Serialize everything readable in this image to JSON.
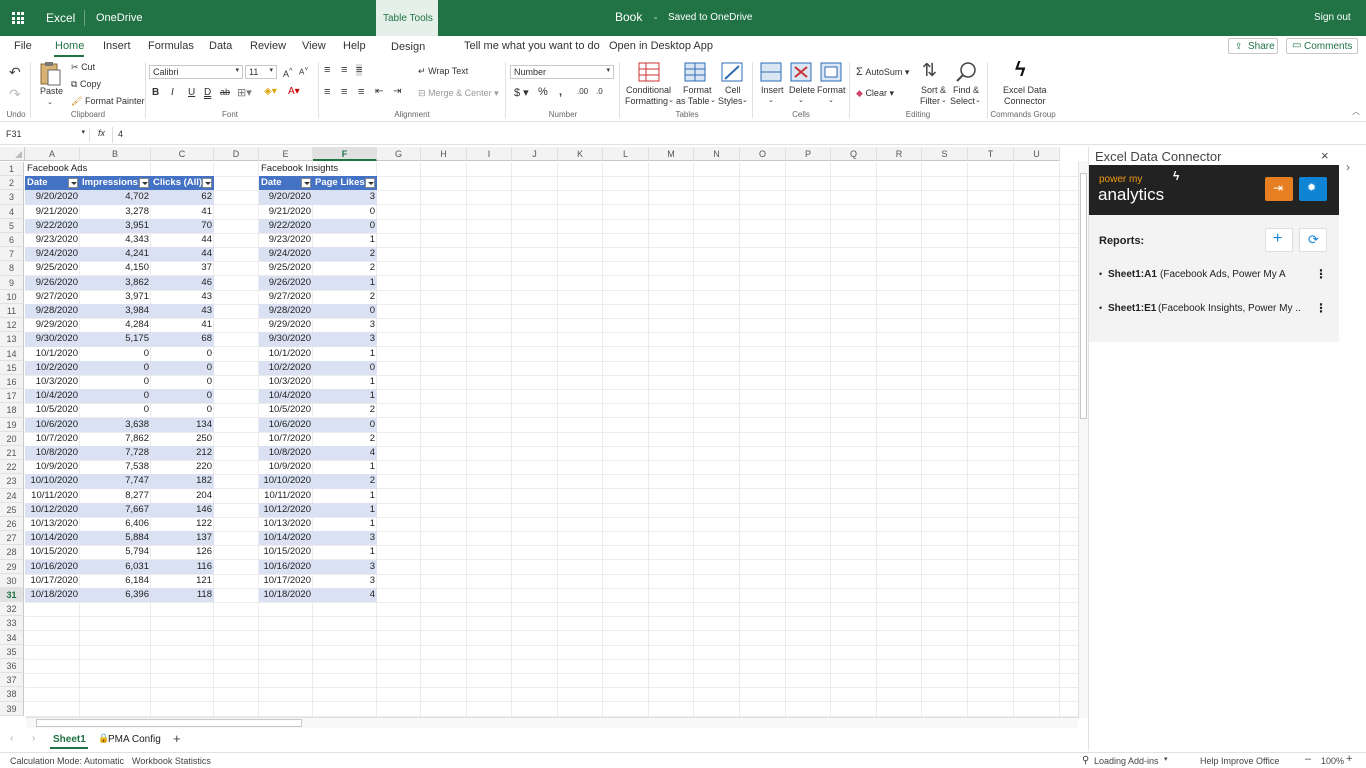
{
  "titlebar": {
    "app": "Excel",
    "location": "OneDrive",
    "context_tab": "Table Tools",
    "book": "Book",
    "save_status": "Saved to OneDrive",
    "signout": "Sign out"
  },
  "tabs": {
    "file": "File",
    "home": "Home",
    "insert": "Insert",
    "formulas": "Formulas",
    "data": "Data",
    "review": "Review",
    "view": "View",
    "help": "Help",
    "design": "Design",
    "tell_me": "Tell me what you want to do",
    "open_desktop": "Open in Desktop App",
    "share": "Share",
    "comments": "Comments"
  },
  "ribbon": {
    "undo_group": "Undo",
    "paste": "Paste",
    "cut": "Cut",
    "copy": "Copy",
    "format_painter": "Format Painter",
    "clipboard": "Clipboard",
    "font_name": "Calibri",
    "font_size": "11",
    "font": "Font",
    "wrap_text": "Wrap Text",
    "merge_center": "Merge & Center",
    "alignment": "Alignment",
    "number_format": "Number",
    "number": "Number",
    "conditional_1": "Conditional",
    "conditional_2": "Formatting",
    "format_table_1": "Format",
    "format_table_2": "as Table",
    "cell_styles_1": "Cell",
    "cell_styles_2": "Styles",
    "tables": "Tables",
    "insert": "Insert",
    "delete": "Delete",
    "format": "Format",
    "cells": "Cells",
    "autosum": "AutoSum",
    "clear": "Clear",
    "sort_1": "Sort &",
    "sort_2": "Filter",
    "find_1": "Find &",
    "find_2": "Select",
    "editing": "Editing",
    "edc_1": "Excel Data",
    "edc_2": "Connector",
    "commands_group": "Commands Group"
  },
  "formula_bar": {
    "name_box": "F31",
    "fx": "fx",
    "value": "4"
  },
  "columns": [
    "A",
    "B",
    "C",
    "D",
    "E",
    "F",
    "G",
    "H",
    "I",
    "J",
    "K",
    "L",
    "M",
    "N",
    "O",
    "P",
    "Q",
    "R",
    "S",
    "T",
    "U"
  ],
  "rows": [
    "1",
    "2",
    "3",
    "4",
    "5",
    "6",
    "7",
    "8",
    "9",
    "10",
    "11",
    "12",
    "13",
    "14",
    "15",
    "16",
    "17",
    "18",
    "19",
    "20",
    "21",
    "22",
    "23",
    "24",
    "25",
    "26",
    "27",
    "28",
    "29",
    "30",
    "31",
    "32",
    "33",
    "34",
    "35",
    "36",
    "37",
    "38",
    "39"
  ],
  "sheet": {
    "title_a": "Facebook Ads",
    "title_e": "Facebook Insights",
    "headers_ads": [
      "Date",
      "Impressions",
      "Clicks (All)"
    ],
    "headers_ins": [
      "Date",
      "Page Likes"
    ],
    "ads": [
      [
        "9/20/2020",
        "4,702",
        "62"
      ],
      [
        "9/21/2020",
        "3,278",
        "41"
      ],
      [
        "9/22/2020",
        "3,951",
        "70"
      ],
      [
        "9/23/2020",
        "4,343",
        "44"
      ],
      [
        "9/24/2020",
        "4,241",
        "44"
      ],
      [
        "9/25/2020",
        "4,150",
        "37"
      ],
      [
        "9/26/2020",
        "3,862",
        "46"
      ],
      [
        "9/27/2020",
        "3,971",
        "43"
      ],
      [
        "9/28/2020",
        "3,984",
        "43"
      ],
      [
        "9/29/2020",
        "4,284",
        "41"
      ],
      [
        "9/30/2020",
        "5,175",
        "68"
      ],
      [
        "10/1/2020",
        "0",
        "0"
      ],
      [
        "10/2/2020",
        "0",
        "0"
      ],
      [
        "10/3/2020",
        "0",
        "0"
      ],
      [
        "10/4/2020",
        "0",
        "0"
      ],
      [
        "10/5/2020",
        "0",
        "0"
      ],
      [
        "10/6/2020",
        "3,638",
        "134"
      ],
      [
        "10/7/2020",
        "7,862",
        "250"
      ],
      [
        "10/8/2020",
        "7,728",
        "212"
      ],
      [
        "10/9/2020",
        "7,538",
        "220"
      ],
      [
        "10/10/2020",
        "7,747",
        "182"
      ],
      [
        "10/11/2020",
        "8,277",
        "204"
      ],
      [
        "10/12/2020",
        "7,667",
        "146"
      ],
      [
        "10/13/2020",
        "6,406",
        "122"
      ],
      [
        "10/14/2020",
        "5,884",
        "137"
      ],
      [
        "10/15/2020",
        "5,794",
        "126"
      ],
      [
        "10/16/2020",
        "6,031",
        "116"
      ],
      [
        "10/17/2020",
        "6,184",
        "121"
      ],
      [
        "10/18/2020",
        "6,396",
        "118"
      ]
    ],
    "ins": [
      [
        "9/20/2020",
        "3"
      ],
      [
        "9/21/2020",
        "0"
      ],
      [
        "9/22/2020",
        "0"
      ],
      [
        "9/23/2020",
        "1"
      ],
      [
        "9/24/2020",
        "2"
      ],
      [
        "9/25/2020",
        "2"
      ],
      [
        "9/26/2020",
        "1"
      ],
      [
        "9/27/2020",
        "2"
      ],
      [
        "9/28/2020",
        "0"
      ],
      [
        "9/29/2020",
        "3"
      ],
      [
        "9/30/2020",
        "3"
      ],
      [
        "10/1/2020",
        "1"
      ],
      [
        "10/2/2020",
        "0"
      ],
      [
        "10/3/2020",
        "1"
      ],
      [
        "10/4/2020",
        "1"
      ],
      [
        "10/5/2020",
        "2"
      ],
      [
        "10/6/2020",
        "0"
      ],
      [
        "10/7/2020",
        "2"
      ],
      [
        "10/8/2020",
        "4"
      ],
      [
        "10/9/2020",
        "1"
      ],
      [
        "10/10/2020",
        "2"
      ],
      [
        "10/11/2020",
        "1"
      ],
      [
        "10/12/2020",
        "1"
      ],
      [
        "10/13/2020",
        "1"
      ],
      [
        "10/14/2020",
        "3"
      ],
      [
        "10/15/2020",
        "1"
      ],
      [
        "10/16/2020",
        "3"
      ],
      [
        "10/17/2020",
        "3"
      ],
      [
        "10/18/2020",
        "4"
      ]
    ]
  },
  "sheet_tabs": {
    "sheet1": "Sheet1",
    "pma_config": "PMA Config",
    "add": "+"
  },
  "status": {
    "calc_mode": "Calculation Mode: Automatic",
    "workbook_stats": "Workbook Statistics",
    "loading": "Loading Add-ins",
    "help_improve": "Help Improve Office",
    "zoom": "100%"
  },
  "pane": {
    "title": "Excel Data Connector",
    "logo_top": "power my",
    "logo_bottom": "analytics",
    "reports_label": "Reports:",
    "reports": [
      {
        "ref": "Sheet1:A1",
        "desc": "(Facebook Ads, Power My An..."
      },
      {
        "ref": "Sheet1:E1",
        "desc": "(Facebook Insights, Power My ..."
      }
    ]
  },
  "colors": {
    "excel_green": "#217346",
    "table_header": "#4472c4",
    "band": "#d9e1f2",
    "pane_dark": "#222222",
    "orange": "#e67e22",
    "blue": "#0f84d4"
  }
}
